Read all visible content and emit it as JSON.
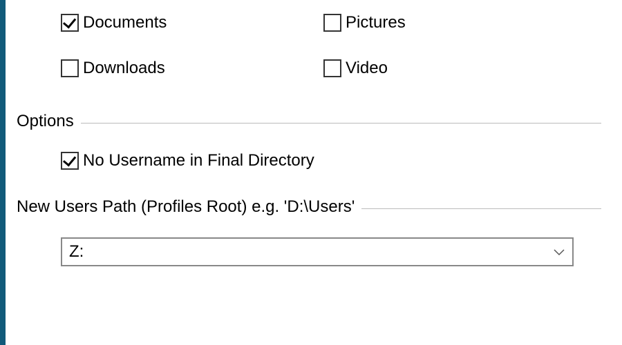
{
  "folders": {
    "documents": {
      "label": "Documents",
      "checked": true
    },
    "downloads": {
      "label": "Downloads",
      "checked": false
    },
    "pictures": {
      "label": "Pictures",
      "checked": false
    },
    "video": {
      "label": "Video",
      "checked": false
    }
  },
  "options": {
    "title": "Options",
    "no_username": {
      "label": "No Username in Final Directory",
      "checked": true
    }
  },
  "new_users_path": {
    "title": "New Users Path (Profiles Root) e.g. 'D:\\Users'",
    "value": "Z:"
  }
}
